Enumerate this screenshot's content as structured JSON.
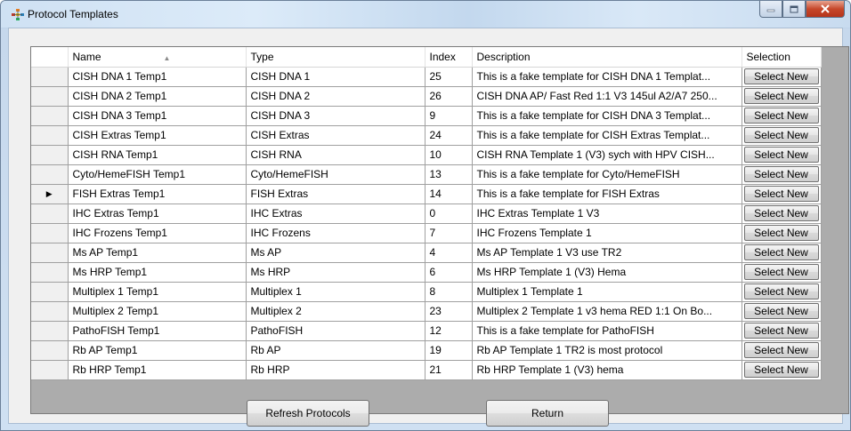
{
  "window": {
    "title": "Protocol Templates"
  },
  "grid": {
    "columns": {
      "name": "Name",
      "type": "Type",
      "index": "Index",
      "description": "Description",
      "selection": "Selection"
    },
    "select_label": "Select New",
    "current_row_marker": "▶",
    "current_row": 6,
    "rows": [
      {
        "name": "CISH DNA 1 Temp1",
        "type": "CISH DNA 1",
        "index": "25",
        "description": "This is a fake template for CISH DNA 1 Templat..."
      },
      {
        "name": "CISH DNA 2 Temp1",
        "type": "CISH DNA 2",
        "index": "26",
        "description": "CISH DNA AP/ Fast Red 1:1 V3 145ul A2/A7 250..."
      },
      {
        "name": "CISH DNA 3 Temp1",
        "type": "CISH DNA 3",
        "index": "9",
        "description": "This is a fake template for CISH DNA 3 Templat..."
      },
      {
        "name": "CISH Extras Temp1",
        "type": "CISH Extras",
        "index": "24",
        "description": "This is a fake template for CISH Extras Templat..."
      },
      {
        "name": "CISH RNA Temp1",
        "type": "CISH RNA",
        "index": "10",
        "description": "CISH RNA Template 1 (V3) sych with HPV CISH..."
      },
      {
        "name": "Cyto/HemeFISH Temp1",
        "type": "Cyto/HemeFISH",
        "index": "13",
        "description": "This is a fake template for Cyto/HemeFISH"
      },
      {
        "name": "FISH Extras Temp1",
        "type": "FISH Extras",
        "index": "14",
        "description": "This is a fake template for FISH Extras"
      },
      {
        "name": "IHC Extras Temp1",
        "type": "IHC Extras",
        "index": "0",
        "description": "IHC Extras Template 1 V3"
      },
      {
        "name": "IHC Frozens Temp1",
        "type": "IHC Frozens",
        "index": "7",
        "description": "IHC Frozens Template 1"
      },
      {
        "name": "Ms AP Temp1",
        "type": "Ms AP",
        "index": "4",
        "description": "Ms AP Template 1 V3 use TR2"
      },
      {
        "name": "Ms HRP Temp1",
        "type": "Ms HRP",
        "index": "6",
        "description": "Ms HRP Template 1 (V3) Hema"
      },
      {
        "name": "Multiplex 1 Temp1",
        "type": "Multiplex 1",
        "index": "8",
        "description": "Multiplex 1 Template 1"
      },
      {
        "name": "Multiplex 2 Temp1",
        "type": "Multiplex 2",
        "index": "23",
        "description": "Multiplex 2 Template 1 v3 hema RED 1:1 On Bo..."
      },
      {
        "name": "PathoFISH Temp1",
        "type": "PathoFISH",
        "index": "12",
        "description": "This is a fake template for PathoFISH"
      },
      {
        "name": "Rb AP Temp1",
        "type": "Rb AP",
        "index": "19",
        "description": "Rb AP Template 1 TR2 is most protocol"
      },
      {
        "name": "Rb HRP Temp1",
        "type": "Rb HRP",
        "index": "21",
        "description": "Rb HRP Template 1 (V3) hema"
      }
    ]
  },
  "buttons": {
    "refresh": "Refresh Protocols",
    "return": "Return"
  }
}
